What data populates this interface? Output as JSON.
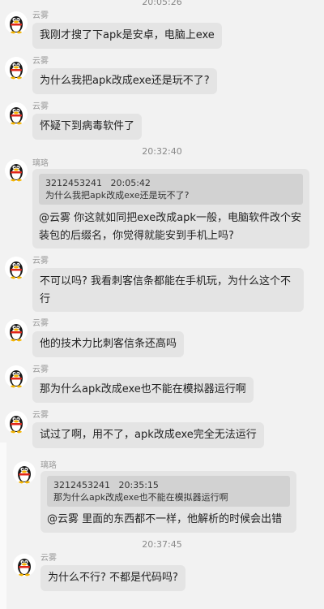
{
  "timestamps": [
    "20:05:26",
    "20:32:40",
    "20:37:45"
  ],
  "messages": [
    {
      "sender": "云雾",
      "text": "我刚才搜了下apk是安卓，电脑上exe"
    },
    {
      "sender": "云雾",
      "text": "为什么我把apk改成exe还是玩不了?"
    },
    {
      "sender": "云雾",
      "text": "怀疑下到病毒软件了"
    },
    {
      "sender": "璃珞",
      "quote_user": "3212453241",
      "quote_time": "20:05:42",
      "quote_text": "为什么我把apk改成exe还是玩不了?",
      "mention": "@云雾",
      "text": " 你这就如同把exe改成apk一般，电脑软件改个安装包的后缀名，你觉得就能安到手机上吗?"
    },
    {
      "sender": "云雾",
      "text": "不可以吗? 我看刺客信条都能在手机玩，为什么这个不行"
    },
    {
      "sender": "云雾",
      "text": "他的技术力比刺客信条还高吗"
    },
    {
      "sender": "云雾",
      "text": "那为什么apk改成exe也不能在模拟器运行啊"
    },
    {
      "sender": "云雾",
      "text": "试过了啊，用不了，apk改成exe完全无法运行"
    },
    {
      "sender": "璃珞",
      "quote_user": "3212453241",
      "quote_time": "20:35:15",
      "quote_text": "那为什么apk改成exe也不能在模拟器运行啊",
      "mention": "@云雾",
      "text": " 里面的东西都不一样，他解析的时候会出错"
    },
    {
      "sender": "云雾",
      "text": "为什么不行? 不都是代码吗?"
    }
  ],
  "icons": {
    "avatar": "qq-penguin-icon"
  }
}
